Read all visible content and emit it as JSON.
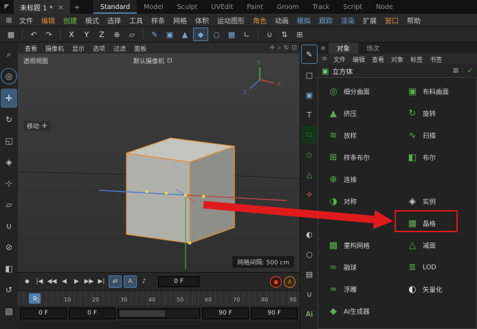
{
  "accent": {
    "blue": "#4d7fae",
    "green": "#56b24a",
    "orange": "#d98e35",
    "red": "#e01b1b"
  },
  "titlebar": {
    "logo": "◤",
    "tab": {
      "label": "未标题 1 *",
      "close": "×"
    },
    "add": "+",
    "layouts": [
      "Standard",
      "Model",
      "Sculpt",
      "UVEdit",
      "Paint",
      "Groom",
      "Track",
      "Script",
      "Node"
    ]
  },
  "menubar": {
    "icon": "▦",
    "items": [
      {
        "label": "文件",
        "color": "#c6c6c6"
      },
      {
        "label": "编辑",
        "color": "#d98e35"
      },
      {
        "label": "创建",
        "color": "#7ac142"
      },
      {
        "label": "模式",
        "color": "#c6c6c6"
      },
      {
        "label": "选择",
        "color": "#c6c6c6"
      },
      {
        "label": "工具",
        "color": "#c6c6c6"
      },
      {
        "label": "样条",
        "color": "#c6c6c6"
      },
      {
        "label": "网格",
        "color": "#c6c6c6"
      },
      {
        "label": "体积",
        "color": "#c6c6c6"
      },
      {
        "label": "运动图形",
        "color": "#c6c6c6"
      },
      {
        "label": "角色",
        "color": "#d98e35"
      },
      {
        "label": "动画",
        "color": "#c6c6c6"
      },
      {
        "label": "模拟",
        "color": "#6aa3d8"
      },
      {
        "label": "跟踪",
        "color": "#6aa3d8"
      },
      {
        "label": "渲染",
        "color": "#6aa3d8"
      },
      {
        "label": "扩展",
        "color": "#c6c6c6"
      },
      {
        "label": "窗口",
        "color": "#d98e35"
      },
      {
        "label": "帮助",
        "color": "#c6c6c6"
      }
    ]
  },
  "toolbar": {
    "icons": [
      {
        "name": "interface-icon",
        "glyph": "▦",
        "color": "#c2c2c2"
      },
      {
        "name": "undo-icon",
        "glyph": "↶",
        "color": "#c2c2c2"
      },
      {
        "name": "redo-icon",
        "glyph": "↷",
        "color": "#c2c2c2"
      },
      {
        "name": "axis-x-button",
        "glyph": "X",
        "color": "#d8d8d8"
      },
      {
        "name": "axis-y-button",
        "glyph": "Y",
        "color": "#d8d8d8"
      },
      {
        "name": "axis-z-button",
        "glyph": "Z",
        "color": "#d8d8d8"
      },
      {
        "name": "coord-system-icon",
        "glyph": "⊕",
        "color": "#c2c2c2"
      },
      {
        "name": "workplane-icon",
        "glyph": "▱",
        "color": "#c2c2c2"
      },
      {
        "name": "spline-pen-icon",
        "glyph": "✎",
        "color": "#72a7d3"
      },
      {
        "name": "cube-primitive-icon",
        "glyph": "▣",
        "color": "#72a7d3"
      },
      {
        "name": "pyramid-primitive-icon",
        "glyph": "▲",
        "color": "#72a7d3"
      },
      {
        "name": "hex-primitive-icon",
        "glyph": "◆",
        "color": "#72a7d3"
      },
      {
        "name": "sphere-primitive-icon",
        "glyph": "○",
        "color": "#72a7d3"
      },
      {
        "name": "array-icon",
        "glyph": "▦",
        "color": "#72a7d3"
      },
      {
        "name": "bracket-icon",
        "glyph": "∟",
        "color": "#c2c2c2"
      },
      {
        "name": "magnet-icon",
        "glyph": "∪",
        "color": "#c2c2c2"
      },
      {
        "name": "arrows-icon",
        "glyph": "⇅",
        "color": "#c2c2c2"
      },
      {
        "name": "grid-add-icon",
        "glyph": "⊞",
        "color": "#c2c2c2"
      }
    ]
  },
  "left_strip": {
    "icons": [
      {
        "name": "search-icon",
        "glyph": "⌕"
      },
      {
        "name": "live-selection-icon",
        "glyph": "◎"
      },
      {
        "name": "move-tool-icon",
        "glyph": "✛"
      },
      {
        "name": "rotate-tool-icon",
        "glyph": "↻"
      },
      {
        "name": "scale-tool-icon",
        "glyph": "◱"
      },
      {
        "name": "last-tool-icon",
        "glyph": "◈"
      },
      {
        "name": "coordinates-icon",
        "glyph": "⊹"
      },
      {
        "name": "workplane-lock-icon",
        "glyph": "▱"
      },
      {
        "name": "snap-icon",
        "glyph": "∪"
      },
      {
        "name": "axis-lock-icon",
        "glyph": "⊘"
      },
      {
        "name": "solo-icon",
        "glyph": "◧"
      },
      {
        "name": "history-icon",
        "glyph": "↺"
      },
      {
        "name": "render-region-icon",
        "glyph": "▧"
      }
    ]
  },
  "mode_strip": {
    "icons": [
      {
        "name": "make-editable-icon",
        "glyph": "✎",
        "color": "#e0e0e0"
      },
      {
        "name": "model-mode-icon",
        "glyph": "□",
        "color": "#bdbdbd"
      },
      {
        "name": "texture-mode-icon",
        "glyph": "▣",
        "color": "#72a7d3"
      },
      {
        "name": "uv-mode-icon",
        "glyph": "T",
        "color": "#bdbdbd"
      },
      {
        "name": "points-mode-icon",
        "glyph": "∷",
        "color": "#56b24a"
      },
      {
        "name": "edges-mode-icon",
        "glyph": "◇",
        "color": "#56b24a"
      },
      {
        "name": "polygons-mode-icon",
        "glyph": "△",
        "color": "#56b24a"
      },
      {
        "name": "axis-mode-icon",
        "glyph": "✛",
        "color": "#cc5555"
      },
      {
        "name": "normals-icon",
        "glyph": "⊙",
        "color": "#bdbdbd"
      },
      {
        "name": "sphere-view-icon",
        "glyph": "◐",
        "color": "#bdbdbd"
      },
      {
        "name": "capsule-icon",
        "glyph": "○",
        "color": "#bdbdbd"
      },
      {
        "name": "plane-icon",
        "glyph": "▤",
        "color": "#bdbdbd"
      },
      {
        "name": "snap-magnet-icon",
        "glyph": "∪",
        "color": "#bdbdbd"
      },
      {
        "name": "ai-tools-icon",
        "glyph": "Ai",
        "color": "#9fd06a"
      }
    ]
  },
  "viewport": {
    "menu": [
      "查看",
      "摄像机",
      "显示",
      "选项",
      "过滤",
      "面板"
    ],
    "nav_icons": [
      {
        "name": "pan-view-icon",
        "glyph": "✛"
      },
      {
        "name": "zoom-view-icon",
        "glyph": "⌕"
      },
      {
        "name": "rotate-view-icon",
        "glyph": "↻"
      },
      {
        "name": "toggle-view-icon",
        "glyph": "⊡"
      }
    ],
    "view_label": "透视视图",
    "camera_label": "默认摄像机",
    "camera_icon": "⊡",
    "tooltip": {
      "label": "移动",
      "glyph": "✛"
    },
    "grid_label": "网格间隔: 500 cm",
    "gizmo": {
      "x": "X",
      "y": "Y",
      "z": "Z"
    }
  },
  "timeline": {
    "transport": [
      {
        "name": "key-icon",
        "glyph": "◆"
      },
      {
        "name": "goto-start-button",
        "glyph": "|◀"
      },
      {
        "name": "prev-key-button",
        "glyph": "◀◀"
      },
      {
        "name": "prev-frame-button",
        "glyph": "◀"
      },
      {
        "name": "play-button",
        "glyph": "▶"
      },
      {
        "name": "next-key-button",
        "glyph": "▶▶"
      },
      {
        "name": "goto-end-button",
        "glyph": "▶|"
      }
    ],
    "loop_glyph": "⇄",
    "autokey_label": "A",
    "sound_glyph": "♪",
    "frame_field": "0 F",
    "record_glyph": "●",
    "record_a": "A",
    "ruler": [
      "0",
      "10",
      "20",
      "30",
      "40",
      "50",
      "60",
      "70",
      "80",
      "90"
    ],
    "current_frame": "0",
    "range_fields": [
      "0 F",
      "0 F",
      "90 F",
      "90 F"
    ]
  },
  "right_panel": {
    "burger": "≡",
    "tabs": [
      {
        "label": "对象"
      },
      {
        "label": "场次"
      }
    ],
    "menu": [
      "文件",
      "编辑",
      "查看",
      "对象",
      "标签",
      "书签"
    ],
    "object": {
      "glyph": "▣",
      "label": "立方体",
      "extra": "▦",
      "dots": "∶",
      "check": "✓"
    },
    "palette": {
      "rows": [
        {
          "l": {
            "label": "细分曲面",
            "glyph": "◎",
            "color": "#56b24a"
          },
          "r": {
            "label": "布料曲面",
            "glyph": "▣",
            "color": "#56b24a"
          }
        },
        {
          "l": {
            "label": "挤压",
            "glyph": "▲",
            "color": "#56b24a"
          },
          "r": {
            "label": "旋转",
            "glyph": "↻",
            "color": "#56b24a"
          }
        },
        {
          "l": {
            "label": "放样",
            "glyph": "≋",
            "color": "#56b24a"
          },
          "r": {
            "label": "扫描",
            "glyph": "∿",
            "color": "#56b24a"
          }
        },
        {
          "l": {
            "label": "样条布尔",
            "glyph": "⊞",
            "color": "#56b24a"
          },
          "r": {
            "label": "布尔",
            "glyph": "◧",
            "color": "#56b24a"
          }
        },
        {
          "l": {
            "label": "连接",
            "glyph": "⊕",
            "color": "#56b24a"
          }
        },
        {
          "l": {
            "label": "对称",
            "glyph": "◑",
            "color": "#56b24a"
          },
          "r": {
            "label": "实例",
            "glyph": "◈",
            "color": "#c8c8c8"
          }
        },
        {
          "r": {
            "label": "晶格",
            "glyph": "▦",
            "color": "#56b24a"
          }
        },
        {
          "l": {
            "label": "重构网格",
            "glyph": "▩",
            "color": "#56b24a"
          },
          "r": {
            "label": "减面",
            "glyph": "△",
            "color": "#56b24a"
          }
        },
        {
          "l": {
            "label": "融球",
            "glyph": "∞",
            "color": "#56b24a"
          },
          "r": {
            "label": "LOD",
            "glyph": "≣",
            "color": "#56b24a"
          }
        },
        {
          "l": {
            "label": "浮雕",
            "glyph": "≈",
            "color": "#56b24a"
          },
          "r": {
            "label": "矢量化",
            "glyph": "◐",
            "color": "#dddddd"
          }
        },
        {
          "l": {
            "label": "AI生成器",
            "glyph": "◆",
            "color": "#56b24a"
          }
        }
      ]
    }
  }
}
